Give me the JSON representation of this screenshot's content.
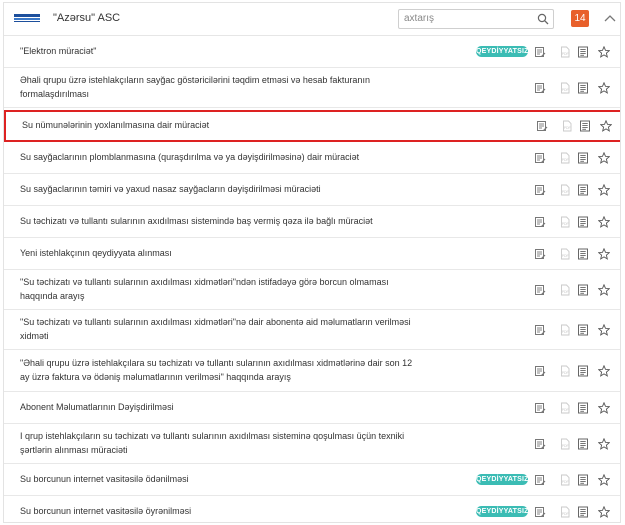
{
  "header": {
    "org_title": "\"Azərsu\" ASC",
    "search_placeholder": "axtarış",
    "notification_count": "14",
    "colors": {
      "badge": "#e8602b",
      "accent": "#3bbcb4",
      "highlight": "#d22222"
    },
    "icons": [
      "azersu-logo-icon",
      "search-icon",
      "chevron-up-icon"
    ]
  },
  "rows": [
    {
      "label": "\"Elektron müraciət\"",
      "badge": "QEYDİYYATSIZ",
      "highlighted": false
    },
    {
      "label": "Əhali qrupu üzrə istehlakçıların sayğac göstəricilərini təqdim etməsi və hesab fakturanın formalaşdırılması",
      "badge": "",
      "highlighted": false
    },
    {
      "label": "Su nümunələrinin yoxlanılmasına dair müraciət",
      "badge": "",
      "highlighted": true
    },
    {
      "label": "Su sayğaclarının plomblanmasına (quraşdırılma və ya dəyişdirilməsinə) dair müraciət",
      "badge": "",
      "highlighted": false
    },
    {
      "label": "Su sayğaclarının təmiri və yaxud nasaz sayğacların dəyişdirilməsi müraciəti",
      "badge": "",
      "highlighted": false
    },
    {
      "label": "Su təchizatı və tullantı sularının axıdılması sistemində baş vermiş qəza ilə bağlı müraciət",
      "badge": "",
      "highlighted": false
    },
    {
      "label": "Yeni istehlakçının qeydiyyata alınması",
      "badge": "",
      "highlighted": false
    },
    {
      "label": "\"Su təchizatı və tullantı sularının axıdılması xidmətləri\"ndən istifadəyə görə borcun olmaması haqqında arayış",
      "badge": "",
      "highlighted": false
    },
    {
      "label": "\"Su təchizatı və tullantı sularının axıdılması xidmətləri\"nə dair abonentə aid məlumatların verilməsi xidməti",
      "badge": "",
      "highlighted": false
    },
    {
      "label": "\"Əhali qrupu üzrə istehlakçılara su təchizatı və tullantı sularının axıdılması xidmətlərinə dair son 12 ay üzrə faktura və ödəniş məlumatlarının verilməsi\" haqqında arayış",
      "badge": "",
      "highlighted": false
    },
    {
      "label": "Abonent Məlumatlarının Dəyişdirilməsi",
      "badge": "",
      "highlighted": false
    },
    {
      "label": "I qrup istehlakçıların su təchizatı və tullantı sularının axıdılması sisteminə qoşulması üçün texniki şərtlərin alınması müraciəti",
      "badge": "",
      "highlighted": false
    },
    {
      "label": "Su borcunun internet vasitəsilə ödənilməsi",
      "badge": "QEYDİYYATSIZ",
      "highlighted": false
    },
    {
      "label": "Su borcunun internet vasitəsilə öyrənilməsi",
      "badge": "QEYDİYYATSIZ",
      "highlighted": false
    }
  ],
  "row_icons": [
    "edit-document-icon",
    "pdf-file-icon",
    "list-document-icon",
    "star-icon"
  ]
}
